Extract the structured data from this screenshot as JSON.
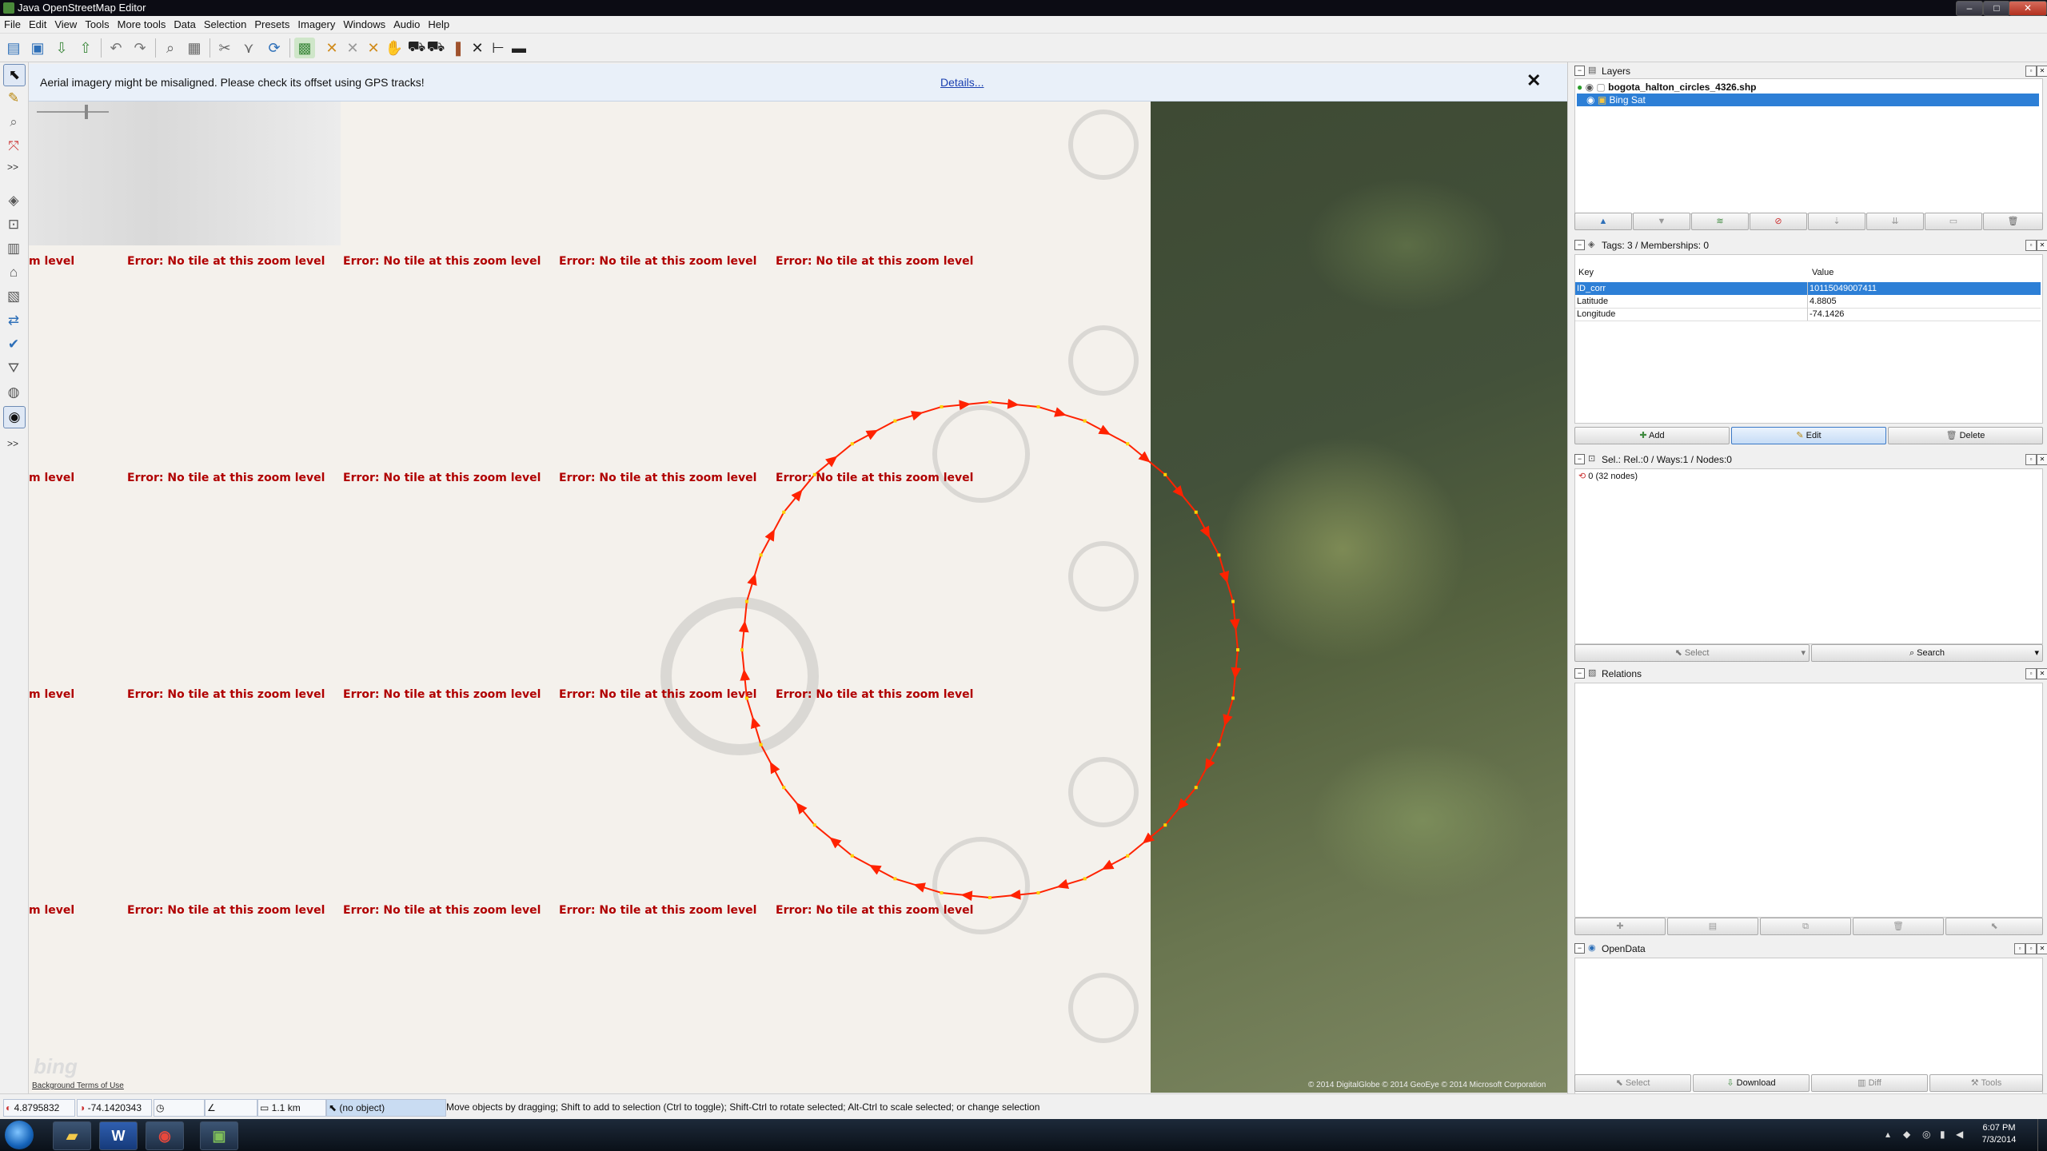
{
  "window": {
    "title": "Java OpenStreetMap Editor"
  },
  "menu": [
    "File",
    "Edit",
    "View",
    "Tools",
    "More tools",
    "Data",
    "Selection",
    "Presets",
    "Imagery",
    "Windows",
    "Audio",
    "Help"
  ],
  "banner": {
    "message": "Aerial imagery might be misaligned. Please check its offset using GPS tracks!",
    "link": "Details...",
    "close": "✕"
  },
  "map": {
    "error_text": "Error: No tile at this zoom level",
    "partial_error": "m level",
    "bing_logo": "bing",
    "bing_terms": "Background Terms of Use",
    "attribution": "© 2014 DigitalGlobe © 2014 GeoEye © 2014 Microsoft Corporation"
  },
  "layers": {
    "title": "Layers",
    "items": [
      {
        "name": "bogota_halton_circles_4326.shp",
        "active": true
      },
      {
        "name": "Bing Sat",
        "active": false
      }
    ]
  },
  "tags": {
    "title": "Tags: 3 / Memberships: 0",
    "key_header": "Key",
    "value_header": "Value",
    "rows": [
      {
        "key": "ID_corr",
        "value": "10115049007411"
      },
      {
        "key": "Latitude",
        "value": "4.8805"
      },
      {
        "key": "Longitude",
        "value": "-74.1426"
      }
    ],
    "buttons": {
      "add": "Add",
      "edit": "Edit",
      "delete": "Delete"
    }
  },
  "selection": {
    "title": "Sel.: Rel.:0 / Ways:1 / Nodes:0",
    "items": [
      "0 (32 nodes)"
    ],
    "select_label": "Select",
    "search_label": "Search"
  },
  "relations": {
    "title": "Relations"
  },
  "opendata": {
    "title": "OpenData",
    "buttons": {
      "select": "Select",
      "download": "Download",
      "diff": "Diff",
      "tools": "Tools"
    }
  },
  "status": {
    "lat": "4.8795832",
    "lon": "-74.1420343",
    "distance": "1.1 km",
    "object": "(no object)",
    "help": "Move objects by dragging; Shift to add to selection (Ctrl to toggle); Shift-Ctrl to rotate selected; Alt-Ctrl to scale selected; or change selection"
  },
  "taskbar": {
    "time": "6:07 PM",
    "date": "7/3/2014"
  },
  "colors": {
    "error": "#b00000",
    "way": "#ff2200",
    "selection": "#2d7fd6"
  }
}
